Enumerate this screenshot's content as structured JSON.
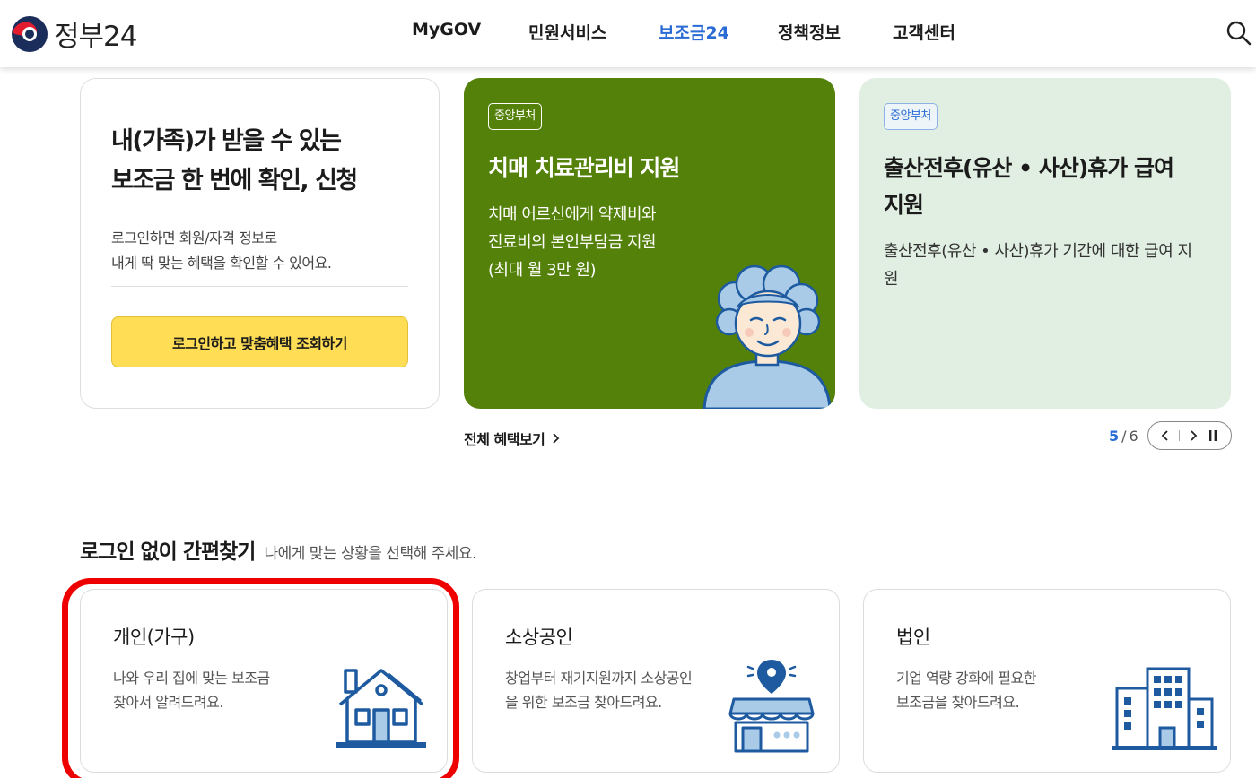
{
  "header": {
    "logo_text": "정부24",
    "nav": [
      "MyGOV",
      "민원서비스",
      "보조금24",
      "정책정보",
      "고객센터"
    ],
    "active_nav": "보조금24",
    "search_icon": "search-icon"
  },
  "intro_card": {
    "title_line1": "내(가족)가 받을 수 있는",
    "title_line2": "보조금 한 번에 확인, 신청",
    "desc_line1": "로그인하면 회원/자격 정보로",
    "desc_line2": "내게 딱 맞는 혜택을 확인할 수 있어요.",
    "button_label": "로그인하고 맞춤혜택 조회하기"
  },
  "slides": [
    {
      "badge": "중앙부처",
      "title": "치매 치료관리비 지원",
      "desc_lines": [
        "치매 어르신에게 약제비와",
        "진료비의 본인부담금 지원",
        "(최대 월 3만 원)"
      ],
      "bg_color": "#548109",
      "illustration": "elderly-woman-illustration"
    },
    {
      "badge": "중앙부처",
      "title_line1": "출산전후(유산 • 사산)휴가 급여",
      "title_line2": "지원",
      "desc_line1": "출산전후(유산 • 사산)휴가 기간에 대한 급여 지",
      "desc_line2": "원",
      "bg_color": "#e1efe3"
    }
  ],
  "more_link": "전체 혜택보기",
  "pager": {
    "current": "5",
    "separator": "/",
    "total": "6"
  },
  "section": {
    "title": "로그인 없이 간편찾기",
    "subtitle": "나에게 맞는 상황을 선택해 주세요."
  },
  "categories": [
    {
      "title": "개인(가구)",
      "desc_line1": "나와 우리 집에 맞는 보조금",
      "desc_line2": "찾아서 알려드려요.",
      "icon": "house-icon"
    },
    {
      "title": "소상공인",
      "desc_line1": "창업부터 재기지원까지 소상공인",
      "desc_line2": "을 위한 보조금 찾아드려요.",
      "icon": "store-icon"
    },
    {
      "title": "법인",
      "desc_line1": "기업 역량 강화에 필요한",
      "desc_line2": "보조금을 찾아드려요.",
      "icon": "building-icon"
    }
  ],
  "colors": {
    "accent_blue": "#2a6bd6",
    "button_yellow": "#ffdd54",
    "highlight_red": "#ee0000",
    "icon_blue": "#1d5aa0"
  }
}
